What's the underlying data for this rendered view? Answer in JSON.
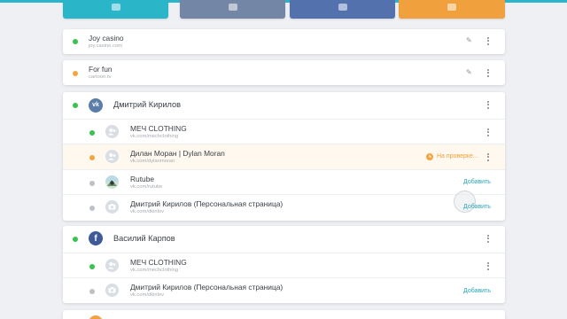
{
  "colors": {
    "teal": "#2bb5c9",
    "vk_blue": "#5b7ea8",
    "facebook_blue": "#3e5a98",
    "orange": "#f0a03c",
    "online_green": "#37c34d",
    "pending_orange": "#f3a63f",
    "offline_gray": "#bdc1c6",
    "link_teal": "#2aa6bd"
  },
  "top_buttons": [
    {
      "name": "teal",
      "color": "#2bb5c9"
    },
    {
      "name": "vk",
      "color": "#7386a6"
    },
    {
      "name": "facebook",
      "color": "#5271ad"
    },
    {
      "name": "orange",
      "color": "#f0a03c"
    }
  ],
  "sites": [
    {
      "title": "Joy casino",
      "url": "joy.casino.com",
      "status": "online"
    },
    {
      "title": "For fun",
      "url": "cartoon.tv",
      "status": "pending"
    }
  ],
  "vk_group": {
    "name": "Дмитрий Кирилов",
    "icon": "vk-icon",
    "status": "online",
    "items": [
      {
        "title": "МЕЧ CLOTHING",
        "url": "vk.com/mechclothing",
        "status": "online",
        "avatar": "group-icon",
        "action": "menu"
      },
      {
        "title": "Дилан Моран | Dylan Moran",
        "url": "vk.com/dylanmoran",
        "status": "pending",
        "avatar": "group-icon",
        "action": "menu",
        "badge": "На проверке..."
      },
      {
        "title": "Rutube",
        "url": "vk.com/rutube",
        "status": "offline",
        "avatar": "rutube-photo",
        "action": "add",
        "action_label": "Добавить"
      },
      {
        "title": "Дмитрий Кирилов (Персональная страница)",
        "url": "vk.com/dkirilov",
        "status": "offline",
        "avatar": "camera-icon",
        "action": "add",
        "action_label": "Добавить"
      }
    ]
  },
  "fb_group": {
    "name": "Василий Карпов",
    "icon": "facebook-icon",
    "status": "online",
    "items": [
      {
        "title": "МЕЧ CLOTHING",
        "url": "vk.com/mechclothing",
        "status": "online",
        "avatar": "group-icon",
        "action": "menu"
      },
      {
        "title": "Дмитрий Кирилов (Персональная страница)",
        "url": "vk.com/dkirilov",
        "status": "offline",
        "avatar": "camera-icon",
        "action": "add",
        "action_label": "Добавить"
      }
    ]
  }
}
